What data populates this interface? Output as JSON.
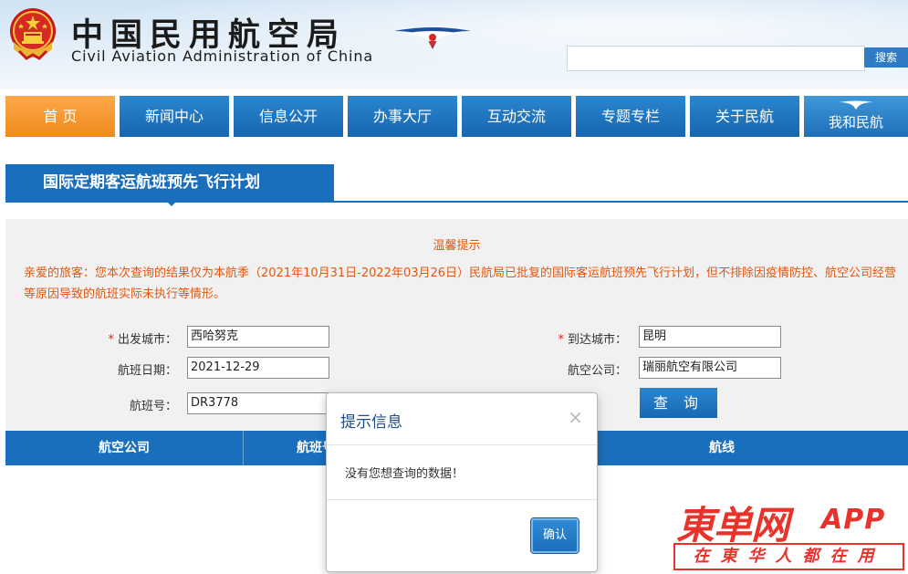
{
  "header": {
    "title_cn": "中国民用航空局",
    "title_en": "Civil Aviation Administration of China",
    "search_button": "搜索"
  },
  "nav": {
    "items": [
      {
        "label": "首 页",
        "active": true
      },
      {
        "label": "新闻中心"
      },
      {
        "label": "信息公开"
      },
      {
        "label": "办事大厅"
      },
      {
        "label": "互动交流"
      },
      {
        "label": "专题专栏"
      },
      {
        "label": "关于民航"
      },
      {
        "label": "我和民航"
      }
    ]
  },
  "section": {
    "title": "国际定期客运航班预先飞行计划"
  },
  "notice": {
    "title": "温馨提示",
    "text": "亲爱的旅客：您本次查询的结果仅为本航季（2021年10月31日-2022年03月26日）民航局已批复的国际客运航班预先飞行计划，但不排除因疫情防控、航空公司经营等原因导致的航班实际未执行等情形。"
  },
  "form": {
    "departure_label": "出发城市：",
    "departure_value": "西哈努克",
    "arrival_label": "到达城市：",
    "arrival_value": "昆明",
    "date_label": "航班日期：",
    "date_value": "2021-12-29",
    "airline_label": "航空公司：",
    "airline_value": "瑞丽航空有限公司",
    "flight_label": "航班号：",
    "flight_value": "DR3778",
    "query_button": "查 询",
    "required_mark": "*"
  },
  "table": {
    "headers": [
      "航空公司",
      "航班号",
      "航线"
    ]
  },
  "modal": {
    "title": "提示信息",
    "close": "×",
    "message": "没有您想查询的数据！",
    "ok_button": "确认"
  },
  "watermark": {
    "main": "東单网",
    "app": "APP",
    "sub": "在東华人都在用"
  },
  "colors": {
    "primary_blue": "#1a6fbd",
    "nav_active_orange": "#f08a1c",
    "notice_orange": "#e4570f",
    "watermark_red": "#e8332c"
  }
}
